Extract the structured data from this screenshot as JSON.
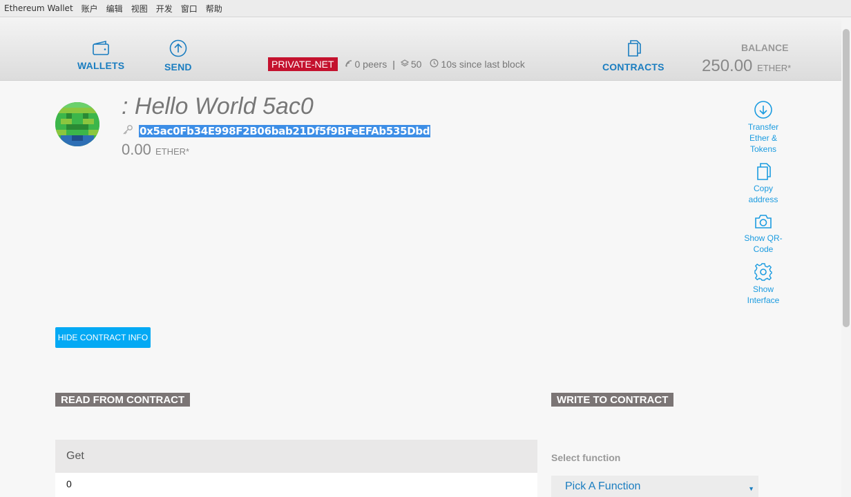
{
  "menubar": {
    "app": "Ethereum Wallet",
    "items": [
      "账户",
      "编辑",
      "视图",
      "开发",
      "窗口",
      "帮助"
    ]
  },
  "nav": {
    "wallets": "WALLETS",
    "send": "SEND",
    "contracts": "CONTRACTS"
  },
  "status": {
    "network": "PRIVATE-NET",
    "peers": "0 peers",
    "separator": "|",
    "blocks": "50",
    "last_block": "10s since last block"
  },
  "balance": {
    "label": "BALANCE",
    "value": "250.00",
    "unit": "ETHER*"
  },
  "account": {
    "title": ": Hello World 5ac0",
    "address": "0x5ac0Fb34E998F2B06bab21Df5f9BFeEFAb535Dbd",
    "balance": "0.00",
    "unit": "ETHER*"
  },
  "actions": {
    "transfer": "Transfer Ether & Tokens",
    "copy": "Copy address",
    "qr": "Show QR-Code",
    "interface": "Show Interface"
  },
  "hide_button": "HIDE CONTRACT INFO",
  "read": {
    "header": "READ FROM CONTRACT",
    "function_name": "Get",
    "function_value": "0"
  },
  "write": {
    "header": "WRITE TO CONTRACT",
    "select_label": "Select function",
    "picker": "Pick A Function",
    "arrow": "▼"
  },
  "colors": {
    "accent": "#1a7dc0",
    "badge": "#c4122e",
    "button": "#03a9f4",
    "section_header": "#7b7575"
  }
}
